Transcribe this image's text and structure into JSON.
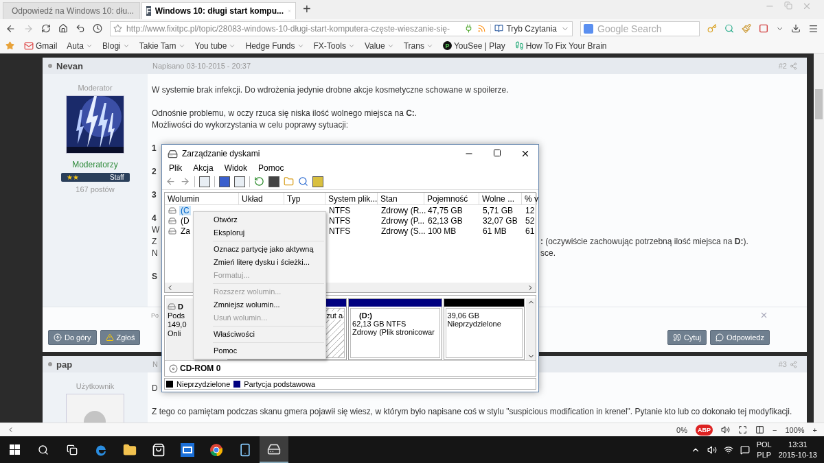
{
  "browser": {
    "tabs": [
      {
        "title": "Odpowiedź na Windows 10: dłu...",
        "selected": false
      },
      {
        "title": "Windows 10: długi start kompu...",
        "letter": "F",
        "selected": true
      }
    ],
    "new_tab": "+",
    "address": "http://www.fixitpc.pl/topic/28083-windows-10-długi-start-komputera-częste-wieszanie-się-",
    "reader_mode": "Tryb Czytania",
    "search": {
      "placeholder": "Google Search"
    },
    "bookmarks": [
      {
        "label": "Gmail",
        "kind": "mail"
      },
      {
        "label": "Auta",
        "kind": "folder"
      },
      {
        "label": "Blogi",
        "kind": "folder"
      },
      {
        "label": "Takie Tam",
        "kind": "folder"
      },
      {
        "label": "You tube",
        "kind": "folder"
      },
      {
        "label": "Hedge Funds",
        "kind": "folder"
      },
      {
        "label": "FX-Tools",
        "kind": "folder"
      },
      {
        "label": "Value",
        "kind": "folder"
      },
      {
        "label": "Trans",
        "kind": "folder"
      },
      {
        "label": "YouSee | Play",
        "kind": "letter",
        "letter": "P"
      },
      {
        "label": "How To Fix Your Brain",
        "kind": "runner"
      }
    ]
  },
  "posts": [
    {
      "author": "Nevan",
      "date": "Napisano 03-10-2015 - 20:37",
      "number": "#2",
      "role": "Moderator",
      "group": "Moderatorzy",
      "badge_marks": "★★",
      "badge": "Staff",
      "post_count": "167 postów",
      "paragraphs": [
        [
          {
            "text": "W systemie brak infekcji. Do wdrożenia jedynie drobne akcje kosmetyczne schowane w spoilerze."
          }
        ],
        [
          {
            "text": "Odnośnie problemu, w oczy rzuca się niska ilość wolnego miejsca na **C:**."
          },
          {
            "text": "Możliwości do wykorzystania w celu poprawy sytuacji:"
          }
        ],
        [
          {
            "text": "1",
            "bold": true
          }
        ],
        [
          {
            "text": "2",
            "bold": true
          }
        ],
        [
          {
            "text": "3",
            "bold": true
          }
        ],
        [
          {
            "text": "4",
            "bold": true
          },
          {
            "text": "W"
          },
          {
            "text": "Z",
            "right": "**:** (oczywiście zachowując potrzebną ilość miejsca na **D:**)."
          },
          {
            "text": "N",
            "right": "sce."
          }
        ],
        [
          {
            "text": "S",
            "bold": true
          }
        ]
      ],
      "footer": "Po",
      "buttons_left": [
        {
          "label": "Do góry",
          "kind": "top"
        },
        {
          "label": "Zgłoś",
          "kind": "report"
        }
      ],
      "buttons_right": [
        {
          "label": "Cytuj",
          "kind": "quote"
        },
        {
          "label": "Odpowiedz",
          "kind": "reply"
        }
      ]
    },
    {
      "author": "pap",
      "date": "N",
      "number": "#3",
      "role": "Użytkownik",
      "paragraphs": [
        [
          {
            "text": "D"
          }
        ],
        [
          {
            "text": "Z tego co pamiętam podczas skanu gmera pojawił się wiesz, w którym było napisane coś w stylu \"suspicious modification in krenel\". Pytanie kto lub co dokonało tej modyfikacji."
          }
        ]
      ]
    }
  ],
  "disk_window": {
    "title": "Zarządzanie dyskami",
    "menu": [
      "Plik",
      "Akcja",
      "Widok",
      "Pomoc"
    ],
    "columns": [
      "Wolumin",
      "Układ",
      "Typ",
      "System plik...",
      "Stan",
      "Pojemność",
      "Wolne ...",
      "% v"
    ],
    "rows": [
      {
        "volume": "(C",
        "file_system": "NTFS",
        "status": "Zdrowy (R...",
        "capacity": "47,75 GB",
        "free": "5,71 GB",
        "percent": "12",
        "selected": true
      },
      {
        "volume": "(D",
        "file_system": "NTFS",
        "status": "Zdrowy (P...",
        "capacity": "62,13 GB",
        "free": "32,07 GB",
        "percent": "52",
        "selected": false
      },
      {
        "volume": "Za",
        "file_system": "NTFS",
        "status": "Zdrowy (S...",
        "capacity": "100 MB",
        "free": "61 MB",
        "percent": "61",
        "selected": false
      }
    ],
    "disk": {
      "name": "D",
      "lines": [
        "Pods",
        "149,0",
        "Onli"
      ]
    },
    "partitions": [
      {
        "kind": "primary",
        "selected": true,
        "lines": [
          "zut a"
        ]
      },
      {
        "kind": "primary",
        "selected": false,
        "name": "(D:)",
        "lines": [
          "62,13 GB NTFS",
          "Zdrowy (Plik stronicowar"
        ]
      },
      {
        "kind": "unallocated",
        "selected": false,
        "lines": [
          "39,06 GB",
          "Nieprzydzielone"
        ]
      }
    ],
    "cdrom": "CD-ROM 0",
    "legend": [
      {
        "label": "Nieprzydzielone",
        "color": "#000000"
      },
      {
        "label": "Partycja podstawowa",
        "color": "#000080"
      }
    ]
  },
  "context_menu": [
    {
      "kind": "item",
      "label": "Otwórz",
      "disabled": false
    },
    {
      "kind": "item",
      "label": "Eksploruj",
      "disabled": false
    },
    {
      "kind": "separator"
    },
    {
      "kind": "item",
      "label": "Oznacz partycję jako aktywną",
      "disabled": false
    },
    {
      "kind": "item",
      "label": "Zmień literę dysku i ścieżki...",
      "disabled": false
    },
    {
      "kind": "item",
      "label": "Formatuj...",
      "disabled": true
    },
    {
      "kind": "separator"
    },
    {
      "kind": "item",
      "label": "Rozszerz wolumin...",
      "disabled": true
    },
    {
      "kind": "item",
      "label": "Zmniejsz wolumin...",
      "disabled": false
    },
    {
      "kind": "item",
      "label": "Usuń wolumin...",
      "disabled": true
    },
    {
      "kind": "separator"
    },
    {
      "kind": "item",
      "label": "Właściwości",
      "disabled": false
    },
    {
      "kind": "separator"
    },
    {
      "kind": "item",
      "label": "Pomoc",
      "disabled": false
    }
  ],
  "status_bar": {
    "block_rate": "0%",
    "adblock": "ABP",
    "zoom_out": "−",
    "zoom": "100%",
    "zoom_in": "+"
  },
  "taskbar": {
    "apps": [
      {
        "kind": "edge",
        "selected": false
      },
      {
        "kind": "explorer",
        "selected": false
      },
      {
        "kind": "store",
        "selected": false
      },
      {
        "kind": "maxthon",
        "selected": false
      },
      {
        "kind": "chrome",
        "selected": false
      },
      {
        "kind": "phone",
        "selected": false
      },
      {
        "kind": "disk",
        "selected": true
      }
    ],
    "language": "POL",
    "layout": "PLP",
    "time": "13:31",
    "date": "2015-10-13"
  }
}
